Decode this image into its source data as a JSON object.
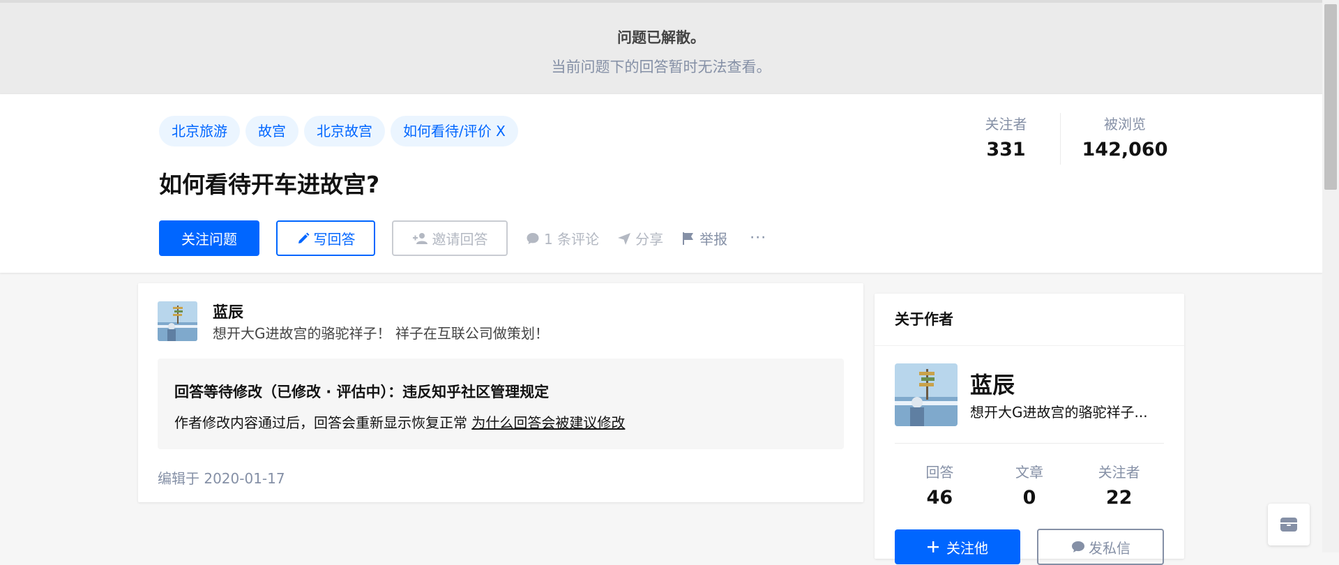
{
  "banner": {
    "title": "问题已解散。",
    "subtitle": "当前问题下的回答暂时无法查看。"
  },
  "question": {
    "tags": [
      "北京旅游",
      "故宫",
      "北京故宫",
      "如何看待/评价 X"
    ],
    "title": "如何看待开车进故宫?",
    "stats": {
      "followers_label": "关注者",
      "followers": "331",
      "views_label": "被浏览",
      "views": "142,060"
    },
    "actions": {
      "follow_label": "关注问题",
      "write_label": "写回答",
      "invite_label": "邀请回答",
      "comment_label": "1 条评论",
      "share_label": "分享",
      "report_label": "举报",
      "more_label": "···"
    }
  },
  "answer": {
    "author_name": "蓝辰",
    "author_bio": "想开大G进故宫的骆驼祥子！ 祥子在互联公司做策划！",
    "notice_title": "回答等待修改（已修改 · 评估中）：违反知乎社区管理规定",
    "notice_text": "作者修改内容通过后，回答会重新显示恢复正常 ",
    "notice_link": "为什么回答会被建议修改",
    "edit_time": "编辑于 2020-01-17"
  },
  "about_author": {
    "header": "关于作者",
    "name": "蓝辰",
    "bio": "想开大G进故宫的骆驼祥子...",
    "stats": [
      {
        "label": "回答",
        "value": "46"
      },
      {
        "label": "文章",
        "value": "0"
      },
      {
        "label": "关注者",
        "value": "22"
      }
    ],
    "follow_label": "关注他",
    "message_label": "发私信"
  },
  "colors": {
    "brand": "#0066ff",
    "tag_bg": "#ebf5ff",
    "muted": "#8590a6"
  },
  "icons": {
    "write": "pencil-icon",
    "invite": "add-person-icon",
    "comment": "comment-bubble-icon",
    "share": "paper-plane-icon",
    "report": "flag-icon",
    "float": "box-icon"
  }
}
